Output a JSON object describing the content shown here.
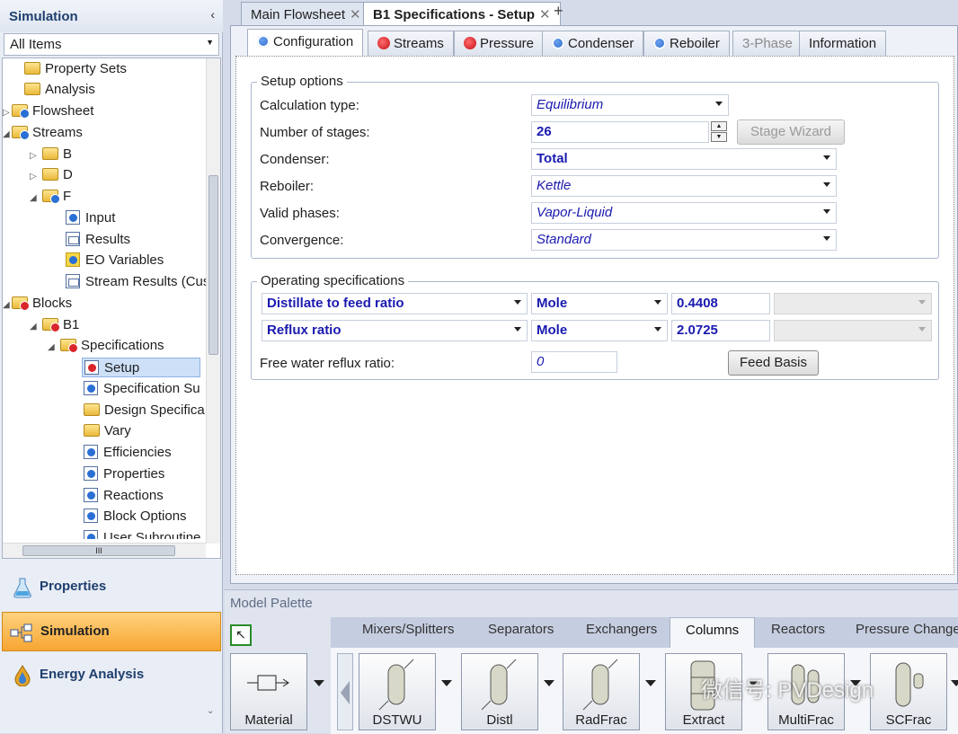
{
  "nav": {
    "title": "Simulation",
    "filter": "All Items",
    "tree": [
      {
        "label": "Property Sets"
      },
      {
        "label": "Analysis"
      },
      {
        "label": "Flowsheet"
      },
      {
        "label": "Streams"
      },
      {
        "label": "B"
      },
      {
        "label": "D"
      },
      {
        "label": "F"
      },
      {
        "label": "Input"
      },
      {
        "label": "Results"
      },
      {
        "label": "EO Variables"
      },
      {
        "label": "Stream Results (Cus"
      },
      {
        "label": "Blocks"
      },
      {
        "label": "B1"
      },
      {
        "label": "Specifications"
      },
      {
        "label": "Setup"
      },
      {
        "label": "Specification Su"
      },
      {
        "label": "Design Specifica"
      },
      {
        "label": "Vary"
      },
      {
        "label": "Efficiencies"
      },
      {
        "label": "Properties"
      },
      {
        "label": "Reactions"
      },
      {
        "label": "Block Options"
      },
      {
        "label": "User Subroutine"
      }
    ],
    "sections": {
      "properties": "Properties",
      "simulation": "Simulation",
      "energy": "Energy Analysis"
    }
  },
  "doc_tabs": {
    "main": "Main Flowsheet",
    "spec": "B1 Specifications - Setup",
    "add": "+"
  },
  "form_tabs": [
    "Configuration",
    "Streams",
    "Pressure",
    "Condenser",
    "Reboiler",
    "3-Phase",
    "Information"
  ],
  "setup": {
    "group_title": "Setup options",
    "calc_type_label": "Calculation type:",
    "calc_type": "Equilibrium",
    "stages_label": "Number of stages:",
    "stages": "26",
    "stage_wizard": "Stage Wizard",
    "condenser_label": "Condenser:",
    "condenser": "Total",
    "reboiler_label": "Reboiler:",
    "reboiler": "Kettle",
    "phases_label": "Valid phases:",
    "phases": "Vapor-Liquid",
    "convergence_label": "Convergence:",
    "convergence": "Standard"
  },
  "opspec": {
    "group_title": "Operating specifications",
    "row1": {
      "spec": "Distillate to feed ratio",
      "basis": "Mole",
      "value": "0.4408"
    },
    "row2": {
      "spec": "Reflux ratio",
      "basis": "Mole",
      "value": "2.0725"
    },
    "free_water_label": "Free water reflux ratio:",
    "free_water": "0",
    "feed_basis": "Feed Basis"
  },
  "palette": {
    "title": "Model Palette",
    "tabs": [
      "Mixers/Splitters",
      "Separators",
      "Exchangers",
      "Columns",
      "Reactors",
      "Pressure Changer"
    ],
    "models": [
      "Material",
      "DSTWU",
      "Distl",
      "RadFrac",
      "Extract",
      "MultiFrac",
      "SCFrac"
    ]
  },
  "watermark": "微信号: PVDesign",
  "colors": {
    "accent": "#f7a531",
    "ok": "#1f5cc1",
    "error": "#c40f18",
    "field_text": "#1a1ab0"
  }
}
